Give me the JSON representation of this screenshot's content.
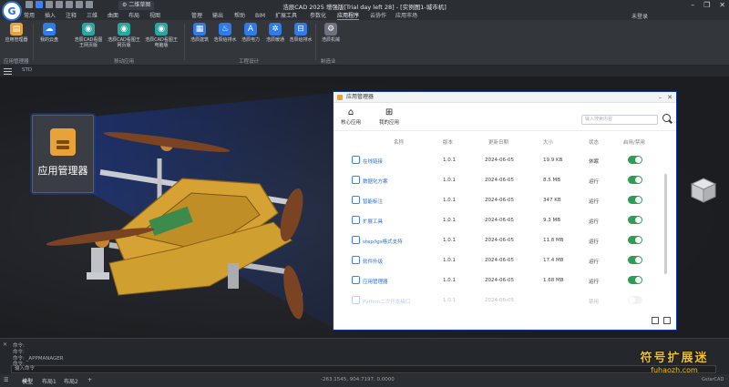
{
  "window": {
    "title": "浩辰CAD 2025 增强版[Trial day left 28] - [实例图1-城市机]",
    "doc_tab": "二维草图",
    "controls": [
      "–",
      "❐",
      "✕"
    ]
  },
  "menu": {
    "tabs": [
      "常用",
      "插入",
      "注释",
      "三维",
      "曲面",
      "布局",
      "视图",
      "管理",
      "输出",
      "帮助",
      "BIM",
      "扩展工具",
      "参数化",
      "应用程序",
      "云协作",
      "应用市场"
    ],
    "active": "应用程序",
    "login": "未登录"
  },
  "ribbon": {
    "buttons": [
      {
        "label": "应用管理器",
        "icon": "app-manager-icon"
      },
      {
        "label": "我的云盘",
        "icon": "cloud-drive-icon"
      },
      {
        "label": "浩辰CAD看图王网页版",
        "icon": "web-viewer-icon"
      },
      {
        "label": "浩辰CAD看图王网页版",
        "icon": "web-viewer-icon"
      },
      {
        "label": "浩辰CAD看图王电脑版",
        "icon": "pc-viewer-icon"
      },
      {
        "label": "浩辰建筑",
        "icon": "architecture-icon"
      },
      {
        "label": "浩辰给排水",
        "icon": "water-supply-icon"
      },
      {
        "label": "浩辰电力",
        "icon": "power-icon"
      },
      {
        "label": "浩辰暖通",
        "icon": "hvac-icon"
      },
      {
        "label": "浩辰给排水",
        "icon": "drainage-icon"
      },
      {
        "label": "浩辰机械",
        "icon": "mechanical-icon"
      }
    ],
    "groups": [
      "应用管理器",
      "移动应用",
      "工程设计",
      "制造业"
    ]
  },
  "docstrip": {
    "label": "STD"
  },
  "popup": {
    "label": "应用管理器"
  },
  "dialog": {
    "title": "应用管理器",
    "tabs": [
      {
        "label": "核心应用",
        "icon": "home-icon"
      },
      {
        "label": "我的应用",
        "icon": "apps-grid-icon"
      }
    ],
    "search_placeholder": "输入搜索内容",
    "columns": [
      "名称",
      "版本",
      "更新日期",
      "大小",
      "状态",
      "启用/禁用"
    ],
    "rows": [
      {
        "name": "在线链接",
        "version": "1.0.1",
        "date": "2024-06-05",
        "size": "19.9 KB",
        "status": "休眠",
        "enabled": true
      },
      {
        "name": "数据化方案",
        "version": "1.0.1",
        "date": "2024-06-05",
        "size": "8.5 MB",
        "status": "运行",
        "enabled": true
      },
      {
        "name": "智能标注",
        "version": "1.0.1",
        "date": "2024-06-05",
        "size": "347 KB",
        "status": "运行",
        "enabled": true
      },
      {
        "name": "扩展工具",
        "version": "1.0.1",
        "date": "2024-06-05",
        "size": "9.3 MB",
        "status": "运行",
        "enabled": true
      },
      {
        "name": "step/igs格式支持",
        "version": "1.0.1",
        "date": "2024-06-05",
        "size": "11.8 MB",
        "status": "运行",
        "enabled": true
      },
      {
        "name": "软件升级",
        "version": "1.0.1",
        "date": "2024-06-05",
        "size": "17.4 MB",
        "status": "运行",
        "enabled": true
      },
      {
        "name": "应用管理器",
        "version": "1.0.1",
        "date": "2024-06-05",
        "size": "1.68 MB",
        "status": "运行",
        "enabled": true
      },
      {
        "name": "Python二次开发接口",
        "version": "1.0.1",
        "date": "2024-06-05",
        "size": "",
        "status": "禁用",
        "enabled": false
      }
    ]
  },
  "command": {
    "lines": [
      "命令:",
      "命令:",
      "命令: _APPMANAGER",
      "命令:"
    ],
    "prompt": "输入命令"
  },
  "status": {
    "tabs": [
      "模型",
      "布局1",
      "布局2"
    ],
    "active": "模型",
    "coords": "-263.1545, 904.7197, 0.0000",
    "brand": "GstarCAD"
  },
  "watermark": {
    "line1": "符号扩展迷",
    "line2": "fuhaozh.com"
  },
  "colors": {
    "accent": "#2f7ce8",
    "toggle_on": "#2f9e54",
    "highlight": "#0f3a9a"
  }
}
